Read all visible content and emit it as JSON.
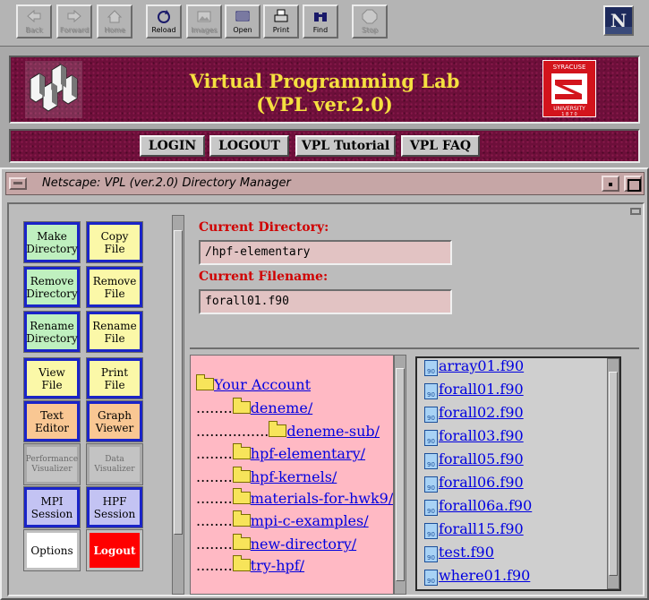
{
  "toolbar": {
    "buttons": [
      {
        "label": "Back",
        "icon": "back-arrow-icon",
        "enabled": false
      },
      {
        "label": "Forward",
        "icon": "forward-arrow-icon",
        "enabled": false
      },
      {
        "label": "Home",
        "icon": "home-icon",
        "enabled": false
      },
      {
        "label": "Reload",
        "icon": "reload-icon",
        "enabled": true
      },
      {
        "label": "Images",
        "icon": "images-icon",
        "enabled": false
      },
      {
        "label": "Open",
        "icon": "open-icon",
        "enabled": true
      },
      {
        "label": "Print",
        "icon": "print-icon",
        "enabled": true
      },
      {
        "label": "Find",
        "icon": "find-binoculars-icon",
        "enabled": true
      },
      {
        "label": "Stop",
        "icon": "stop-icon",
        "enabled": false
      }
    ],
    "logo_letter": "N"
  },
  "banner": {
    "title_line1": "Virtual Programming Lab",
    "title_line2": "(VPL ver.2.0)",
    "university_top": "SYRACUSE",
    "university_bottom": "UNIVERSITY",
    "university_year": "1 8 7 0"
  },
  "nav": {
    "login": "LOGIN",
    "logout": "LOGOUT",
    "tutorial": "VPL Tutorial",
    "faq": "VPL FAQ"
  },
  "window": {
    "title": "Netscape: VPL (ver.2.0) Directory Manager"
  },
  "commands": {
    "make_dir": [
      "Make",
      "Directory"
    ],
    "copy_file": [
      "Copy",
      "File"
    ],
    "remove_dir": [
      "Remove",
      "Directory"
    ],
    "remove_file": [
      "Remove",
      "File"
    ],
    "rename_dir": [
      "Rename",
      "Directory"
    ],
    "rename_file": [
      "Rename",
      "File"
    ],
    "view_file": [
      "View",
      "File"
    ],
    "print_file": [
      "Print",
      "File"
    ],
    "text_editor": [
      "Text",
      "Editor"
    ],
    "graph_viewer": [
      "Graph",
      "Viewer"
    ],
    "perf_vis": [
      "Performance",
      "Visualizer"
    ],
    "data_vis": [
      "Data",
      "Visualizer"
    ],
    "mpi_session": [
      "MPI",
      "Session"
    ],
    "hpf_session": [
      "HPF",
      "Session"
    ],
    "options": "Options",
    "logout": "Logout"
  },
  "directory": {
    "current_dir_label": "Current Directory:",
    "current_dir_value": "/hpf-elementary",
    "current_file_label": "Current Filename:",
    "current_file_value": "forall01.f90"
  },
  "tree": {
    "root": "Your Account",
    "items": [
      {
        "dots": "........",
        "name": "deneme/"
      },
      {
        "dots": "................",
        "name": "deneme-sub/"
      },
      {
        "dots": "........",
        "name": "hpf-elementary/"
      },
      {
        "dots": "........",
        "name": "hpf-kernels/"
      },
      {
        "dots": "........",
        "name": "materials-for-hwk9/"
      },
      {
        "dots": "........",
        "name": "mpi-c-examples/"
      },
      {
        "dots": "........",
        "name": "new-directory/"
      },
      {
        "dots": "........",
        "name": "try-hpf/"
      }
    ]
  },
  "files": {
    "icon_text": "90",
    "items": [
      "array01.f90",
      "forall01.f90",
      "forall02.f90",
      "forall03.f90",
      "forall05.f90",
      "forall06.f90",
      "forall06a.f90",
      "forall15.f90",
      "test.f90",
      "where01.f90"
    ]
  }
}
